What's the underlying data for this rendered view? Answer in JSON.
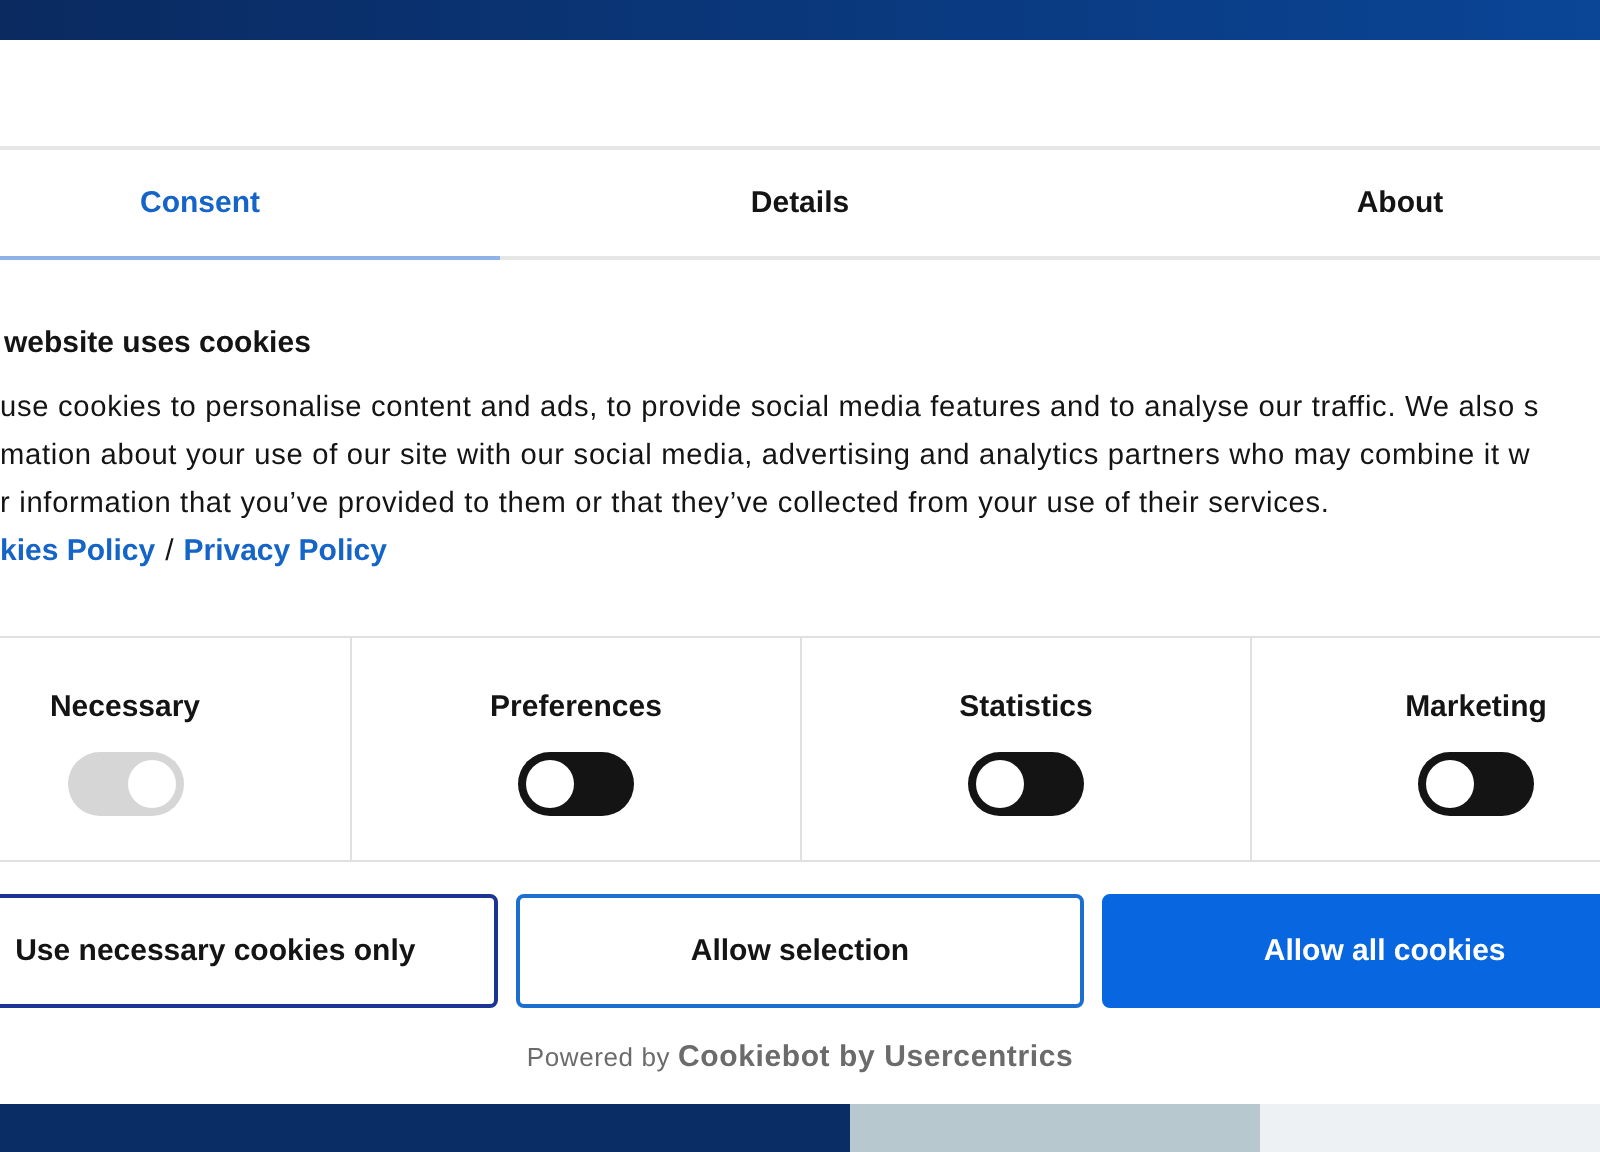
{
  "tabs": [
    {
      "label": "Consent",
      "selected": true
    },
    {
      "label": "Details",
      "selected": false
    },
    {
      "label": "About",
      "selected": false
    }
  ],
  "title": "website uses cookies",
  "description_lines": [
    "use cookies to personalise content and ads, to provide social media features and to analyse our traffic. We also s",
    "mation about your use of our site with our social media, advertising and analytics partners who may combine it w",
    "r information that you’ve provided to them or that they’ve collected from your use of their services."
  ],
  "links": [
    {
      "label": "kies Policy"
    },
    {
      "label": "Privacy Policy"
    }
  ],
  "link_separator": "/",
  "categories": [
    {
      "label": "Necessary",
      "on": true,
      "disabled": true
    },
    {
      "label": "Preferences",
      "on": false,
      "disabled": false
    },
    {
      "label": "Statistics",
      "on": false,
      "disabled": false
    },
    {
      "label": "Marketing",
      "on": false,
      "disabled": false
    }
  ],
  "buttons": [
    {
      "label": "Use necessary cookies only",
      "kind": "outline-dark"
    },
    {
      "label": "Allow selection",
      "kind": "outline"
    },
    {
      "label": "Allow all cookies",
      "kind": "filled"
    }
  ],
  "footer": {
    "prefix": "Powered by",
    "brand": "Cookiebot by Usercentrics"
  }
}
